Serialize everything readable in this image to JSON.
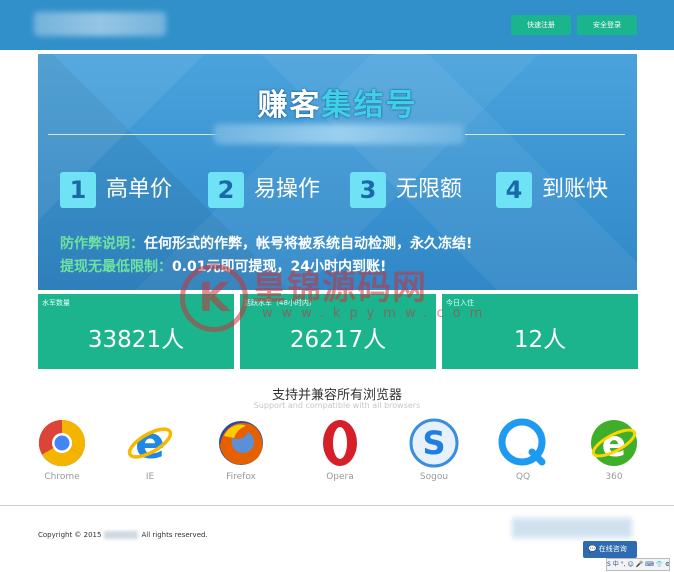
{
  "header": {
    "register_label": "快速注册",
    "login_label": "安全登录"
  },
  "banner": {
    "title_part1": "赚客",
    "title_part2": "集结号",
    "features": [
      {
        "num": "1",
        "label": "高单价"
      },
      {
        "num": "2",
        "label": "易操作"
      },
      {
        "num": "3",
        "label": "无限额"
      },
      {
        "num": "4",
        "label": "到账快"
      }
    ],
    "note1_key": "防作弊说明：",
    "note1_text": "任何形式的作弊，帐号将被系统自动检测，永久冻结!",
    "note2_key": "提现无最低限制：",
    "note2_text": "0.01元即可提现，24小时内到账!"
  },
  "stats": [
    {
      "label": "水军数量",
      "value": "33821人"
    },
    {
      "label": "活跃水军（48小时内）",
      "value": "26217人"
    },
    {
      "label": "今日入住",
      "value": "12人"
    }
  ],
  "browsers": {
    "title": "支持并兼容所有浏览器",
    "subtitle": "Support and compatible with all browsers",
    "items": [
      {
        "name": "Chrome",
        "icon": "chrome-icon"
      },
      {
        "name": "IE",
        "icon": "ie-icon"
      },
      {
        "name": "Firefox",
        "icon": "firefox-icon"
      },
      {
        "name": "Opera",
        "icon": "opera-icon"
      },
      {
        "name": "Sogou",
        "icon": "sogou-icon"
      },
      {
        "name": "QQ",
        "icon": "qq-browser-icon"
      },
      {
        "name": "360",
        "icon": "360-browser-icon"
      }
    ]
  },
  "footer": {
    "copyright_prefix": "Copyright © 2015",
    "copyright_suffix": "All rights reserved.",
    "chat_label": "在线咨询",
    "ime_text": "S 中 °, ☺ 🎤 ⌨ 👕 ⚙"
  },
  "watermark": {
    "letter": "K",
    "text": "皇锦源码网",
    "url": "www.kpymw.com"
  },
  "colors": {
    "header_bg": "#3190c9",
    "button_green": "#1bb58d",
    "stat_green": "#1bb48c",
    "banner_blue": "#3c95d2",
    "accent_cyan": "#3fd0e8"
  }
}
